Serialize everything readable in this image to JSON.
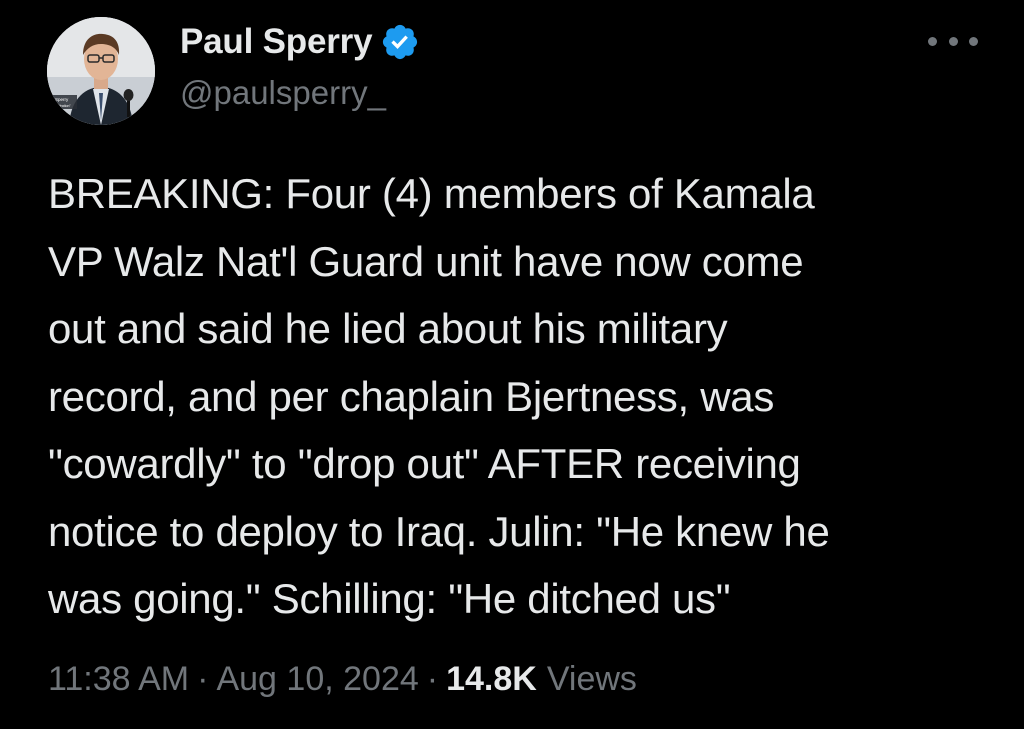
{
  "author": {
    "display_name": "Paul Sperry",
    "handle": "@paulsperry_",
    "verified": true,
    "avatar_caption_lines": [
      "Sperry",
      "\"Infiltration\""
    ]
  },
  "tweet": {
    "text": "BREAKING: Four (4) members of Kamala\nVP Walz Nat'l Guard unit have now come\nout and said he lied about his military\nrecord, and per chaplain Bjertness, was\n\"cowardly\" to \"drop out\" AFTER receiving\nnotice to deploy to Iraq. Julin: \"He knew he\nwas going.\" Schilling: \"He ditched us\""
  },
  "meta": {
    "time": "11:38 AM",
    "separator": "·",
    "date": "Aug 10, 2024",
    "views_count": "14.8K",
    "views_label": "Views"
  },
  "icons": {
    "verified": "verified-badge-icon",
    "more": "more-options-icon"
  },
  "colors": {
    "background": "#000000",
    "primary_text": "#e7e9ea",
    "secondary_text": "#71767b",
    "verified_blue": "#1d9bf0"
  }
}
